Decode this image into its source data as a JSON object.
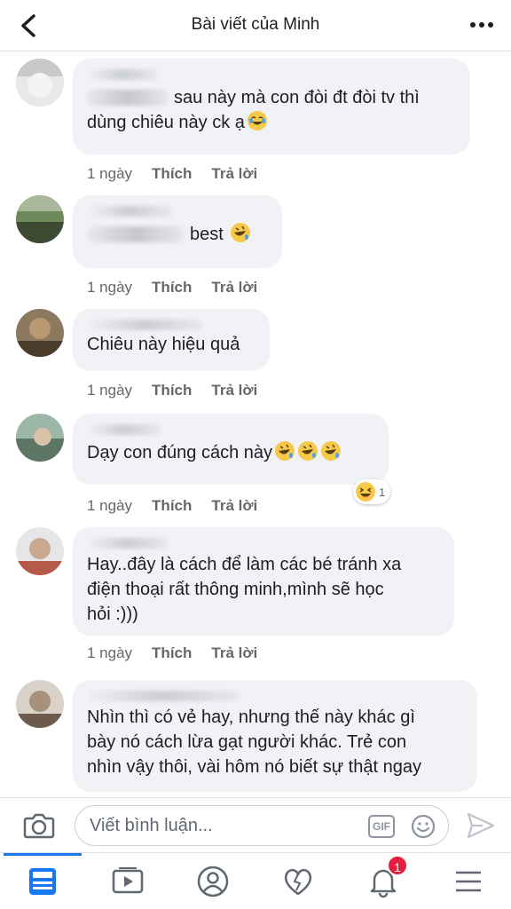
{
  "header": {
    "title": "Bài viết của Minh"
  },
  "comments": [
    {
      "text_after": "sau này mà con đòi đt đòi tv thì\ndùng chiêu này ck ạ",
      "emoji": "joy",
      "time": "1 ngày",
      "like": "Thích",
      "reply": "Trả lời"
    },
    {
      "text_after": "best",
      "emoji": "rofl",
      "time": "1 ngày",
      "like": "Thích",
      "reply": "Trả lời"
    },
    {
      "text": "Chiêu này hiệu quả",
      "time": "1 ngày",
      "like": "Thích",
      "reply": "Trả lời"
    },
    {
      "text": "Dạy con đúng cách này",
      "emoji": "rofl x3",
      "time": "1 ngày",
      "like": "Thích",
      "reply": "Trả lời",
      "reaction_count": "1"
    },
    {
      "text": "Hay..đây là cách để làm các bé tránh xa\nđiện thoại rất thông minh,mình sẽ học\nhỏi :)))",
      "time": "1 ngày",
      "like": "Thích",
      "reply": "Trả lời"
    },
    {
      "text": "Nhìn thì có vẻ hay, nhưng thế này khác gì\nbày nó cách lừa gạt người khác. Trẻ con\nnhìn vậy thôi, vài hôm nó biết sự thật ngay"
    }
  ],
  "composer": {
    "placeholder": "Viết bình luận...",
    "gif_label": "GIF"
  },
  "tabbar": {
    "notifications_badge": "1"
  },
  "colors": {
    "accent": "#1877f2",
    "bubble": "#f0f2f5",
    "badge": "#e41e3f"
  }
}
